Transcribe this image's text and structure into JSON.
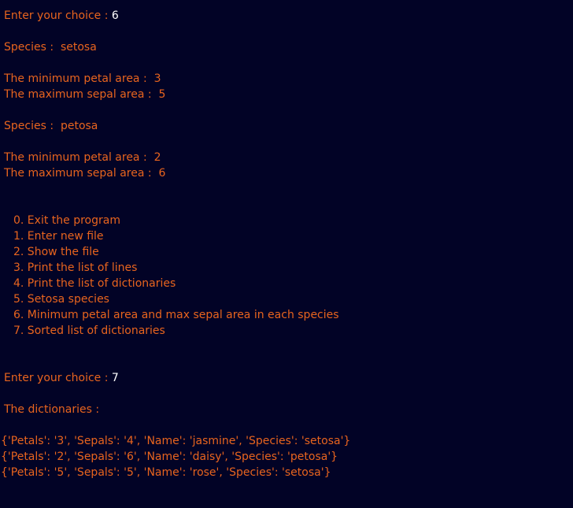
{
  "session": {
    "prompt_1": {
      "label": "Enter your choice : ",
      "value": "6"
    },
    "species_blocks": [
      {
        "species_label": "Species :  setosa",
        "min_petal": "The minimum petal area :  3",
        "max_sepal": "The maximum sepal area :  5"
      },
      {
        "species_label": "Species :  petosa",
        "min_petal": "The minimum petal area :  2",
        "max_sepal": "The maximum sepal area :  6"
      }
    ],
    "menu": [
      "0. Exit the program",
      "1. Enter new file",
      "2. Show the file",
      "3. Print the list of lines",
      "4. Print the list of dictionaries",
      "5. Setosa species",
      "6. Minimum petal area and max sepal area in each species",
      "7. Sorted list of dictionaries"
    ],
    "prompt_2": {
      "label": "Enter your choice : ",
      "value": "7"
    },
    "dict_header": "The dictionaries :",
    "dicts": [
      "{'Petals': '3', 'Sepals': '4', 'Name': 'jasmine', 'Species': 'setosa'}",
      "{'Petals': '2', 'Sepals': '6', 'Name': 'daisy', 'Species': 'petosa'}",
      "{'Petals': '5', 'Sepals': '5', 'Name': 'rose', 'Species': 'setosa'}"
    ]
  },
  "colors": {
    "background": "#020326",
    "text": "#e8641e",
    "input": "#ffffff"
  }
}
